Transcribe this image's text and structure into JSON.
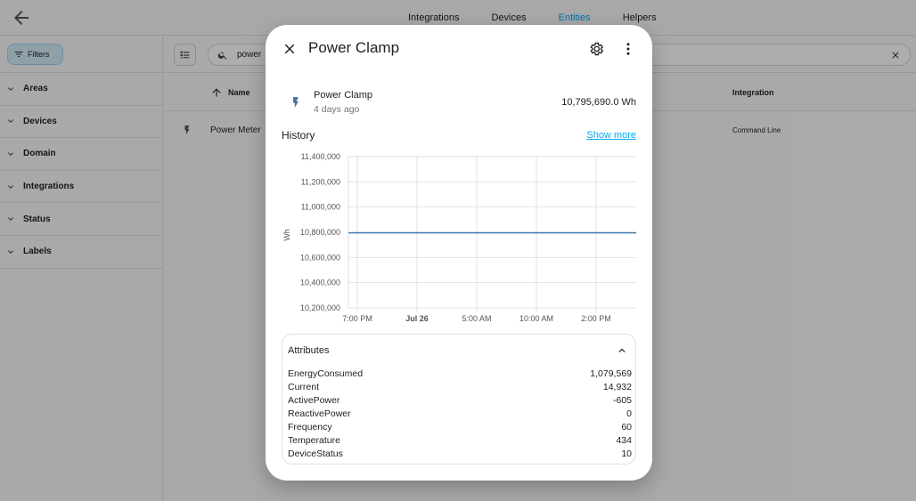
{
  "nav": {
    "tabs": [
      "Integrations",
      "Devices",
      "Entities",
      "Helpers"
    ],
    "active_tab": "Entities"
  },
  "sidebar": {
    "filters_label": "Filters",
    "groups": [
      "Areas",
      "Devices",
      "Domain",
      "Integrations",
      "Status",
      "Labels"
    ]
  },
  "search": {
    "value": "power"
  },
  "table": {
    "columns": {
      "name": "Name",
      "integration": "Integration"
    },
    "rows": [
      {
        "name": "Power Meter",
        "integration": "Command Line"
      }
    ]
  },
  "dialog": {
    "title": "Power Clamp",
    "entity_name": "Power Clamp",
    "last_changed": "4 days ago",
    "state": "10,795,690.0 Wh",
    "history_label": "History",
    "show_more": "Show more",
    "attributes_label": "Attributes",
    "attributes": [
      {
        "name": "EnergyConsumed",
        "value": "1,079,569"
      },
      {
        "name": "Current",
        "value": "14,932"
      },
      {
        "name": "ActivePower",
        "value": "-605"
      },
      {
        "name": "ReactivePower",
        "value": "0"
      },
      {
        "name": "Frequency",
        "value": "60"
      },
      {
        "name": "Temperature",
        "value": "434"
      },
      {
        "name": "DeviceStatus",
        "value": "10"
      }
    ]
  },
  "colors": {
    "accent": "#03a9f4",
    "line": "#4a7ab3"
  },
  "chart_data": {
    "type": "line",
    "ylabel": "Wh",
    "ylim": [
      10200000,
      11400000
    ],
    "y_ticks": [
      11400000,
      11200000,
      11000000,
      10800000,
      10600000,
      10400000,
      10200000
    ],
    "y_tick_labels": [
      "11,400,000",
      "11,200,000",
      "11,000,000",
      "10,800,000",
      "10,600,000",
      "10,400,000",
      "10,200,000"
    ],
    "x_tick_labels": [
      "7:00 PM",
      "Jul 26",
      "5:00 AM",
      "10:00 AM",
      "2:00 PM"
    ],
    "series": [
      {
        "values": [
          10795690,
          10795690
        ]
      }
    ],
    "grid": true
  }
}
